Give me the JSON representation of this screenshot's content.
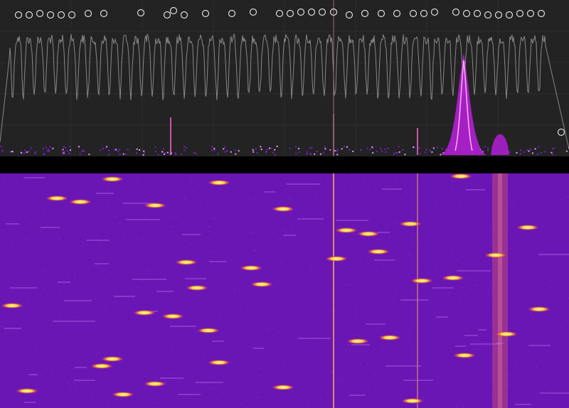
{
  "colors": {
    "spectrum_bg": "#232323",
    "grid": "#2c2c2c",
    "trace": "#9a9a9a",
    "peak_marker": "#dcdcdc",
    "persistence_low": "#7a1cd0",
    "persistence_high": "#ffd84a",
    "divider": "#000000",
    "waterfall_bg": "#6a16b4",
    "waterfall_hot": "#ffe14a",
    "waterfall_line": "#e8a060"
  },
  "icons": {
    "peak_marker": "circle-outline-icon"
  },
  "spectrum": {
    "peak_markers_count": 43
  },
  "waterfall": {
    "colormap": "plasma",
    "persistent_carriers_count": 3
  }
}
